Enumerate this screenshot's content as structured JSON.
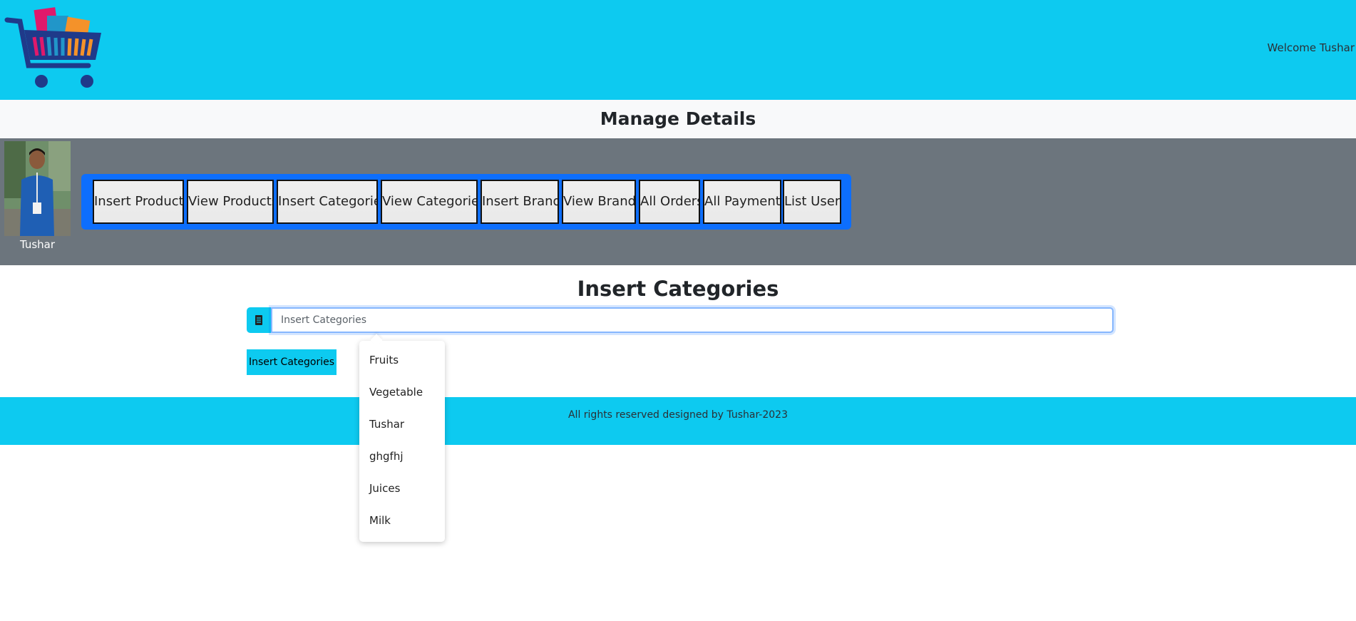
{
  "header": {
    "welcome_text": "Welcome Tushar",
    "logo_icon": "shopping-cart-logo"
  },
  "page_title": "Manage Details",
  "admin": {
    "name": "Tushar",
    "avatar_icon": "user-photo"
  },
  "nav": {
    "buttons": [
      {
        "label": "Insert Products"
      },
      {
        "label": "View Products"
      },
      {
        "label": "Insert Categories"
      },
      {
        "label": "View Categories"
      },
      {
        "label": "Insert Brands"
      },
      {
        "label": "View Brands"
      },
      {
        "label": "All Orders"
      },
      {
        "label": "All Payments"
      },
      {
        "label": "List Users"
      }
    ]
  },
  "form": {
    "title": "Insert Categories",
    "input_placeholder": "Insert Categories",
    "input_icon": "receipt-icon",
    "submit_label": "Insert Categories"
  },
  "autocomplete": {
    "items": [
      "Fruits",
      "Vegetable",
      "Tushar",
      "ghgfhj",
      "Juices",
      "Milk"
    ]
  },
  "footer": {
    "text": "All rights reserved designed by Tushar-2023"
  },
  "colors": {
    "topbar": "#0dcaf0",
    "nav_container": "#0d6efd",
    "graybar": "#6c757d",
    "manage_bar": "#f8f9fa"
  }
}
